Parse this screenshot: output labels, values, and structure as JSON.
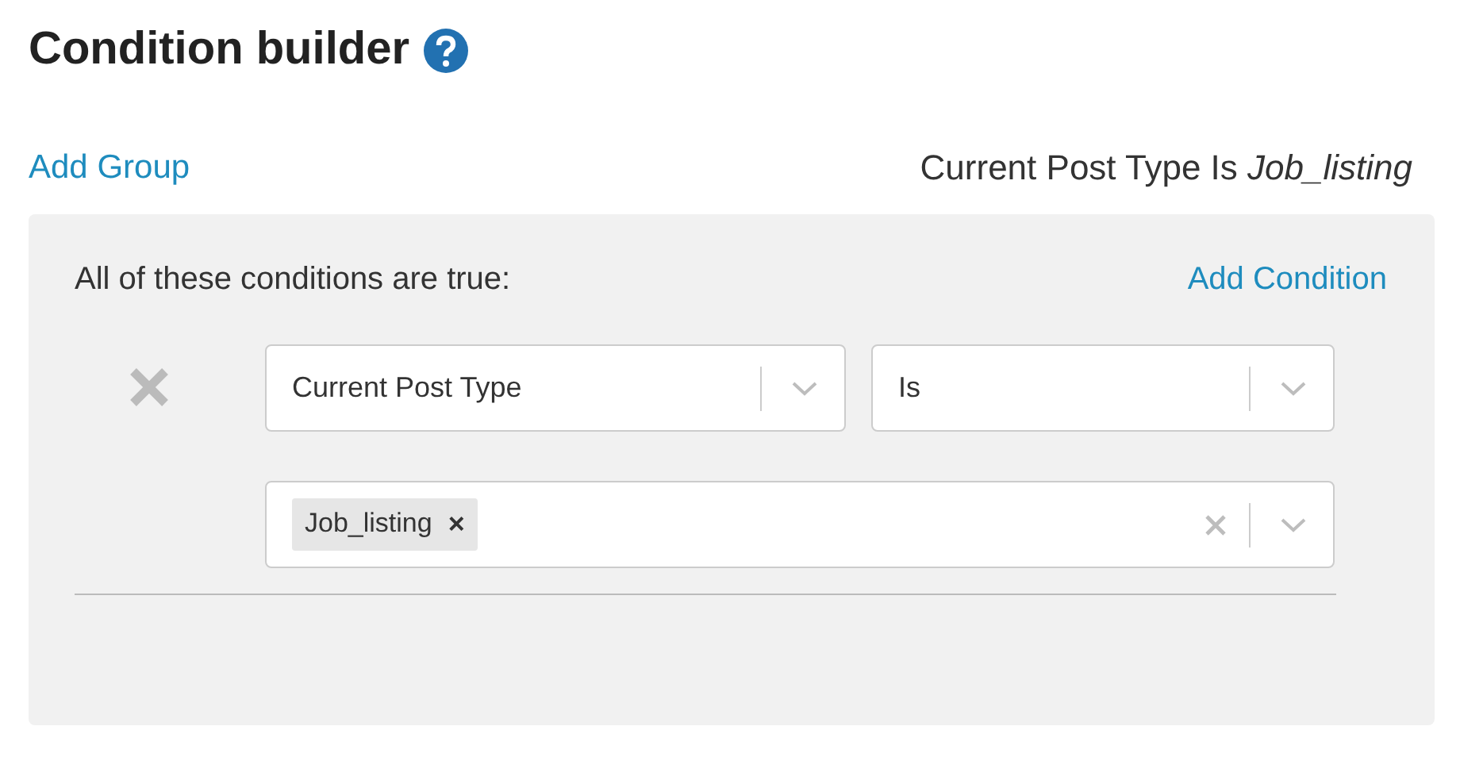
{
  "title": "Condition builder",
  "add_group": "Add Group",
  "summary": "Current Post Type Is *Job_listing*",
  "group": {
    "heading": "All of these conditions are true:",
    "add_condition": "Add Condition",
    "conditions": [
      {
        "field": "Current Post Type",
        "operator": "Is",
        "values": [
          {
            "label": "Job_listing",
            "remove": "×"
          }
        ]
      }
    ]
  }
}
